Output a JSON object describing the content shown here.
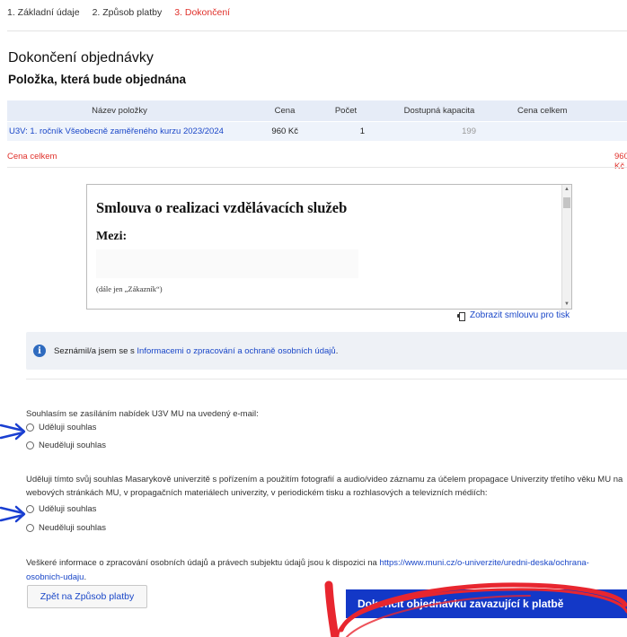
{
  "steps": [
    {
      "label": "1. Základní údaje"
    },
    {
      "label": "2. Způsob platby"
    },
    {
      "label": "3. Dokončení"
    }
  ],
  "page": {
    "title": "Dokončení objednávky",
    "subtitle": "Položka, která bude objednána"
  },
  "table": {
    "headers": {
      "name": "Název položky",
      "price": "Cena",
      "count": "Počet",
      "capacity": "Dostupná kapacita",
      "total": "Cena celkem"
    },
    "row": {
      "name": "U3V: 1. ročník Všeobecně zaměřeného kurzu",
      "year": "2023/2024",
      "price": "960 Kč",
      "count": "1",
      "capacity": "199"
    },
    "total": {
      "label": "Cena celkem",
      "value": "960 Kč"
    }
  },
  "contract": {
    "title": "Smlouva o realizaci vzdělávacích služeb",
    "between": "Mezi:",
    "note": "(dále jen „Zákazník“)"
  },
  "print_link": "Zobrazit smlouvu pro tisk",
  "info": {
    "text": "Seznámil/a jsem se s",
    "link": "Informacemi o zpracování a ochraně osobních údajů"
  },
  "consent1": {
    "question": "Souhlasím se zasíláním nabídek U3V MU na uvedený e-mail:",
    "options": [
      "Uděluji souhlas",
      "Neuděluji souhlas"
    ]
  },
  "consent2": {
    "question": "Uděluji tímto svůj souhlas Masarykově univerzitě s pořízením a použitím fotografií a audio/video záznamu za účelem propagace Univerzity třetího věku MU na webových stránkách MU, v propagačních materiálech univerzity, v periodickém tisku a rozhlasových a televizních médiích:",
    "options": [
      "Uděluji souhlas",
      "Neuděluji souhlas"
    ]
  },
  "footer": {
    "text": "Veškeré informace o zpracování osobních údajů a právech subjektu údajů jsou k dispozici na",
    "link": "https://www.muni.cz/o-univerzite/uredni-deska/ochrana-osobnich-udaju"
  },
  "buttons": {
    "back": "Zpět na Způsob platby",
    "finish": "Dokončit objednávku zavazující k platbě"
  },
  "colors": {
    "accent": "#1338c7",
    "active_step": "#e0312b",
    "annotation": "#e8262f",
    "arrow": "#1a3fd1"
  }
}
